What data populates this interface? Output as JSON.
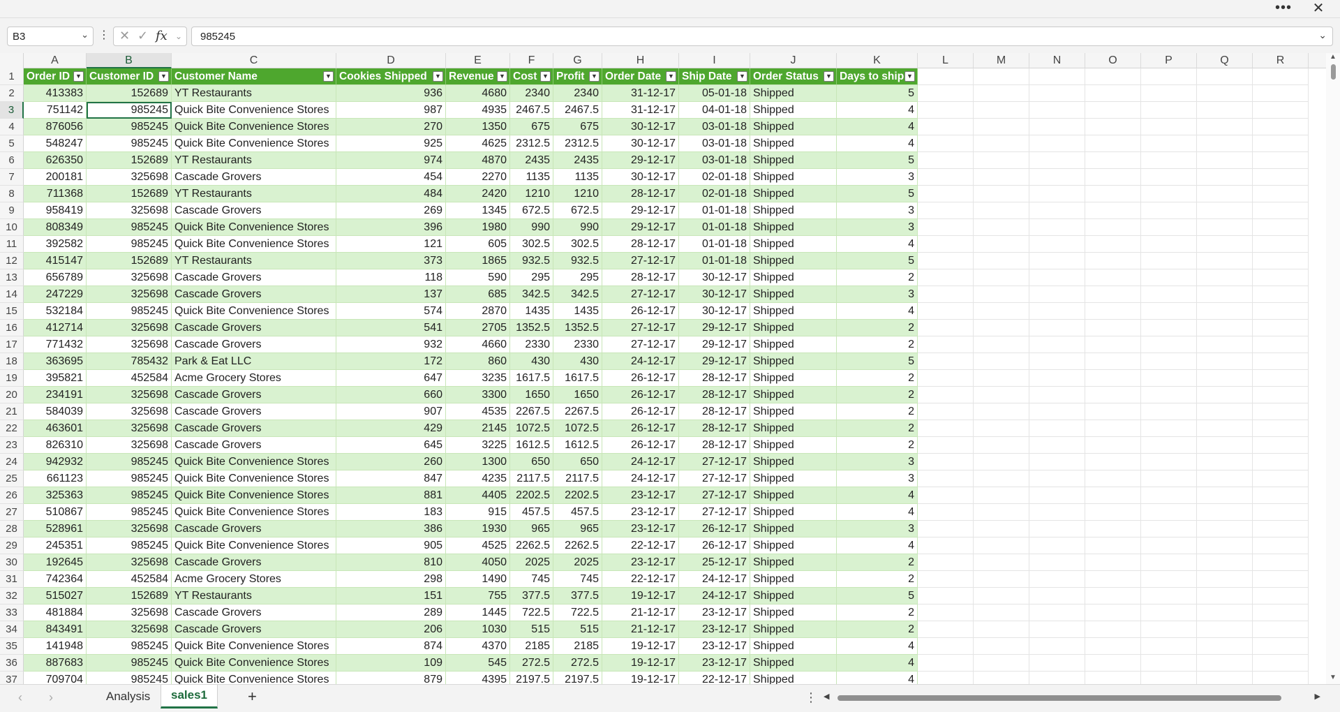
{
  "window": {
    "more_icon": "more-horizontal-icon",
    "close_icon": "close-icon"
  },
  "formula_bar": {
    "name_box": "B3",
    "value": "985245",
    "fx_label": "fx"
  },
  "columns": [
    "A",
    "B",
    "C",
    "D",
    "E",
    "F",
    "G",
    "H",
    "I",
    "J",
    "K",
    "L",
    "M",
    "N",
    "O",
    "P",
    "Q",
    "R"
  ],
  "selected_column": "B",
  "selected_row": 3,
  "table": {
    "headers": [
      "Order ID",
      "Customer ID",
      "Customer Name",
      "Cookies Shipped",
      "Revenue",
      "Cost",
      "Profit",
      "Order Date",
      "Ship Date",
      "Order Status",
      "Days to ship"
    ],
    "rows": [
      [
        "413383",
        "152689",
        "YT Restaurants",
        "936",
        "4680",
        "2340",
        "2340",
        "31-12-17",
        "05-01-18",
        "Shipped",
        "5"
      ],
      [
        "751142",
        "985245",
        "Quick Bite Convenience Stores",
        "987",
        "4935",
        "2467.5",
        "2467.5",
        "31-12-17",
        "04-01-18",
        "Shipped",
        "4"
      ],
      [
        "876056",
        "985245",
        "Quick Bite Convenience Stores",
        "270",
        "1350",
        "675",
        "675",
        "30-12-17",
        "03-01-18",
        "Shipped",
        "4"
      ],
      [
        "548247",
        "985245",
        "Quick Bite Convenience Stores",
        "925",
        "4625",
        "2312.5",
        "2312.5",
        "30-12-17",
        "03-01-18",
        "Shipped",
        "4"
      ],
      [
        "626350",
        "152689",
        "YT Restaurants",
        "974",
        "4870",
        "2435",
        "2435",
        "29-12-17",
        "03-01-18",
        "Shipped",
        "5"
      ],
      [
        "200181",
        "325698",
        "Cascade Grovers",
        "454",
        "2270",
        "1135",
        "1135",
        "30-12-17",
        "02-01-18",
        "Shipped",
        "3"
      ],
      [
        "711368",
        "152689",
        "YT Restaurants",
        "484",
        "2420",
        "1210",
        "1210",
        "28-12-17",
        "02-01-18",
        "Shipped",
        "5"
      ],
      [
        "958419",
        "325698",
        "Cascade Grovers",
        "269",
        "1345",
        "672.5",
        "672.5",
        "29-12-17",
        "01-01-18",
        "Shipped",
        "3"
      ],
      [
        "808349",
        "985245",
        "Quick Bite Convenience Stores",
        "396",
        "1980",
        "990",
        "990",
        "29-12-17",
        "01-01-18",
        "Shipped",
        "3"
      ],
      [
        "392582",
        "985245",
        "Quick Bite Convenience Stores",
        "121",
        "605",
        "302.5",
        "302.5",
        "28-12-17",
        "01-01-18",
        "Shipped",
        "4"
      ],
      [
        "415147",
        "152689",
        "YT Restaurants",
        "373",
        "1865",
        "932.5",
        "932.5",
        "27-12-17",
        "01-01-18",
        "Shipped",
        "5"
      ],
      [
        "656789",
        "325698",
        "Cascade Grovers",
        "118",
        "590",
        "295",
        "295",
        "28-12-17",
        "30-12-17",
        "Shipped",
        "2"
      ],
      [
        "247229",
        "325698",
        "Cascade Grovers",
        "137",
        "685",
        "342.5",
        "342.5",
        "27-12-17",
        "30-12-17",
        "Shipped",
        "3"
      ],
      [
        "532184",
        "985245",
        "Quick Bite Convenience Stores",
        "574",
        "2870",
        "1435",
        "1435",
        "26-12-17",
        "30-12-17",
        "Shipped",
        "4"
      ],
      [
        "412714",
        "325698",
        "Cascade Grovers",
        "541",
        "2705",
        "1352.5",
        "1352.5",
        "27-12-17",
        "29-12-17",
        "Shipped",
        "2"
      ],
      [
        "771432",
        "325698",
        "Cascade Grovers",
        "932",
        "4660",
        "2330",
        "2330",
        "27-12-17",
        "29-12-17",
        "Shipped",
        "2"
      ],
      [
        "363695",
        "785432",
        "Park & Eat LLC",
        "172",
        "860",
        "430",
        "430",
        "24-12-17",
        "29-12-17",
        "Shipped",
        "5"
      ],
      [
        "395821",
        "452584",
        "Acme Grocery Stores",
        "647",
        "3235",
        "1617.5",
        "1617.5",
        "26-12-17",
        "28-12-17",
        "Shipped",
        "2"
      ],
      [
        "234191",
        "325698",
        "Cascade Grovers",
        "660",
        "3300",
        "1650",
        "1650",
        "26-12-17",
        "28-12-17",
        "Shipped",
        "2"
      ],
      [
        "584039",
        "325698",
        "Cascade Grovers",
        "907",
        "4535",
        "2267.5",
        "2267.5",
        "26-12-17",
        "28-12-17",
        "Shipped",
        "2"
      ],
      [
        "463601",
        "325698",
        "Cascade Grovers",
        "429",
        "2145",
        "1072.5",
        "1072.5",
        "26-12-17",
        "28-12-17",
        "Shipped",
        "2"
      ],
      [
        "826310",
        "325698",
        "Cascade Grovers",
        "645",
        "3225",
        "1612.5",
        "1612.5",
        "26-12-17",
        "28-12-17",
        "Shipped",
        "2"
      ],
      [
        "942932",
        "985245",
        "Quick Bite Convenience Stores",
        "260",
        "1300",
        "650",
        "650",
        "24-12-17",
        "27-12-17",
        "Shipped",
        "3"
      ],
      [
        "661123",
        "985245",
        "Quick Bite Convenience Stores",
        "847",
        "4235",
        "2117.5",
        "2117.5",
        "24-12-17",
        "27-12-17",
        "Shipped",
        "3"
      ],
      [
        "325363",
        "985245",
        "Quick Bite Convenience Stores",
        "881",
        "4405",
        "2202.5",
        "2202.5",
        "23-12-17",
        "27-12-17",
        "Shipped",
        "4"
      ],
      [
        "510867",
        "985245",
        "Quick Bite Convenience Stores",
        "183",
        "915",
        "457.5",
        "457.5",
        "23-12-17",
        "27-12-17",
        "Shipped",
        "4"
      ],
      [
        "528961",
        "325698",
        "Cascade Grovers",
        "386",
        "1930",
        "965",
        "965",
        "23-12-17",
        "26-12-17",
        "Shipped",
        "3"
      ],
      [
        "245351",
        "985245",
        "Quick Bite Convenience Stores",
        "905",
        "4525",
        "2262.5",
        "2262.5",
        "22-12-17",
        "26-12-17",
        "Shipped",
        "4"
      ],
      [
        "192645",
        "325698",
        "Cascade Grovers",
        "810",
        "4050",
        "2025",
        "2025",
        "23-12-17",
        "25-12-17",
        "Shipped",
        "2"
      ],
      [
        "742364",
        "452584",
        "Acme Grocery Stores",
        "298",
        "1490",
        "745",
        "745",
        "22-12-17",
        "24-12-17",
        "Shipped",
        "2"
      ],
      [
        "515027",
        "152689",
        "YT Restaurants",
        "151",
        "755",
        "377.5",
        "377.5",
        "19-12-17",
        "24-12-17",
        "Shipped",
        "5"
      ],
      [
        "481884",
        "325698",
        "Cascade Grovers",
        "289",
        "1445",
        "722.5",
        "722.5",
        "21-12-17",
        "23-12-17",
        "Shipped",
        "2"
      ],
      [
        "843491",
        "325698",
        "Cascade Grovers",
        "206",
        "1030",
        "515",
        "515",
        "21-12-17",
        "23-12-17",
        "Shipped",
        "2"
      ],
      [
        "141948",
        "985245",
        "Quick Bite Convenience Stores",
        "874",
        "4370",
        "2185",
        "2185",
        "19-12-17",
        "23-12-17",
        "Shipped",
        "4"
      ],
      [
        "887683",
        "985245",
        "Quick Bite Convenience Stores",
        "109",
        "545",
        "272.5",
        "272.5",
        "19-12-17",
        "23-12-17",
        "Shipped",
        "4"
      ],
      [
        "709704",
        "985245",
        "Quick Bite Convenience Stores",
        "879",
        "4395",
        "2197.5",
        "2197.5",
        "19-12-17",
        "22-12-17",
        "Shipped",
        "4"
      ]
    ]
  },
  "sheets": {
    "tabs": [
      "Analysis",
      "sales1"
    ],
    "active": "sales1",
    "add_label": "+"
  }
}
